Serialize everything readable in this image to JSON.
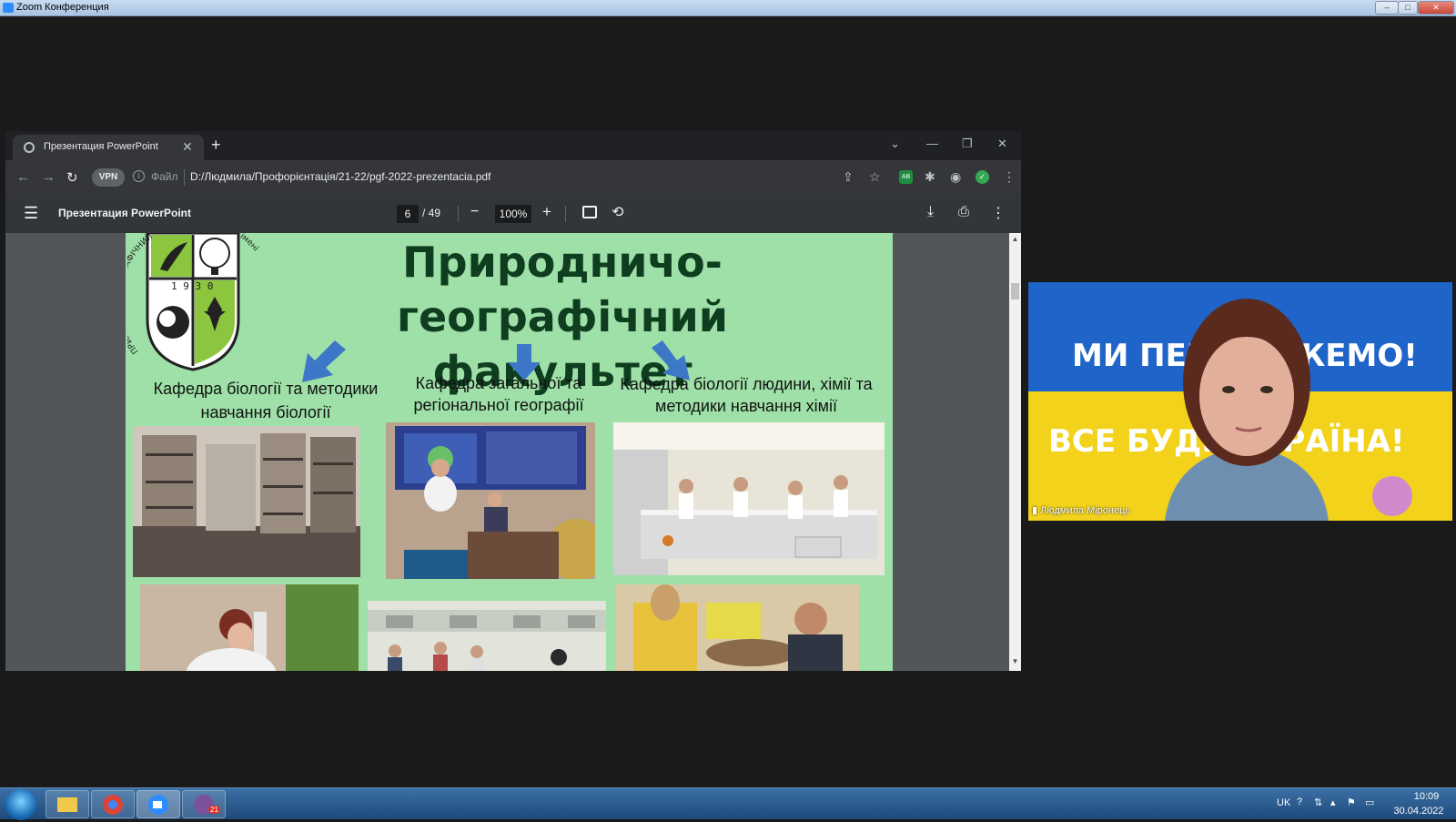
{
  "zoom_window": {
    "title": "Zoom Конференция"
  },
  "browser": {
    "tab_title": "Презентация PowerPoint",
    "file_label": "Файл",
    "vpn_label": "VPN",
    "url": "D:/Людмила/Профорієнтація/21-22/pgf-2022-prezentacia.pdf",
    "extension_badge": "AB"
  },
  "pdf_toolbar": {
    "title": "Презентация PowerPoint",
    "current_page": "6",
    "total_pages": "/ 49",
    "zoom": "100%"
  },
  "slide": {
    "title_line1": "Природничо-географічний",
    "title_line2": "факультет",
    "emblem": {
      "year": "1 9 3 0",
      "ring_text": "ПРИРОДНИЧО-ГЕОГРАФІЧНИЙ ФАКУЛЬТЕТ СумДПУ імені А.С.МАКАРЕНКА"
    },
    "departments": [
      {
        "line1": "Кафедра біології та методики",
        "line2": "навчання біології"
      },
      {
        "line1": "Кафедра загальної та",
        "line2": "регіональної географії"
      },
      {
        "line1": "Кафедра біології людини,  хімії та",
        "line2": "методики навчання хімії"
      }
    ]
  },
  "video": {
    "banner_top": "МИ ПЕРЕМОЖЕМО!",
    "banner_bottom": "ВСЕ БУДЕ УКРАЇНА!",
    "participant_name": "Людмила Міронець"
  },
  "taskbar": {
    "lang": "UK",
    "time": "10:09",
    "date": "30.04.2022",
    "viber_badge": "21"
  },
  "colors": {
    "slide_background": "#9ee0a8",
    "title_color": "#0f3d1f",
    "arrow_color": "#3d78c8",
    "flag_blue": "#0057b7",
    "flag_yellow": "#ffd700"
  }
}
